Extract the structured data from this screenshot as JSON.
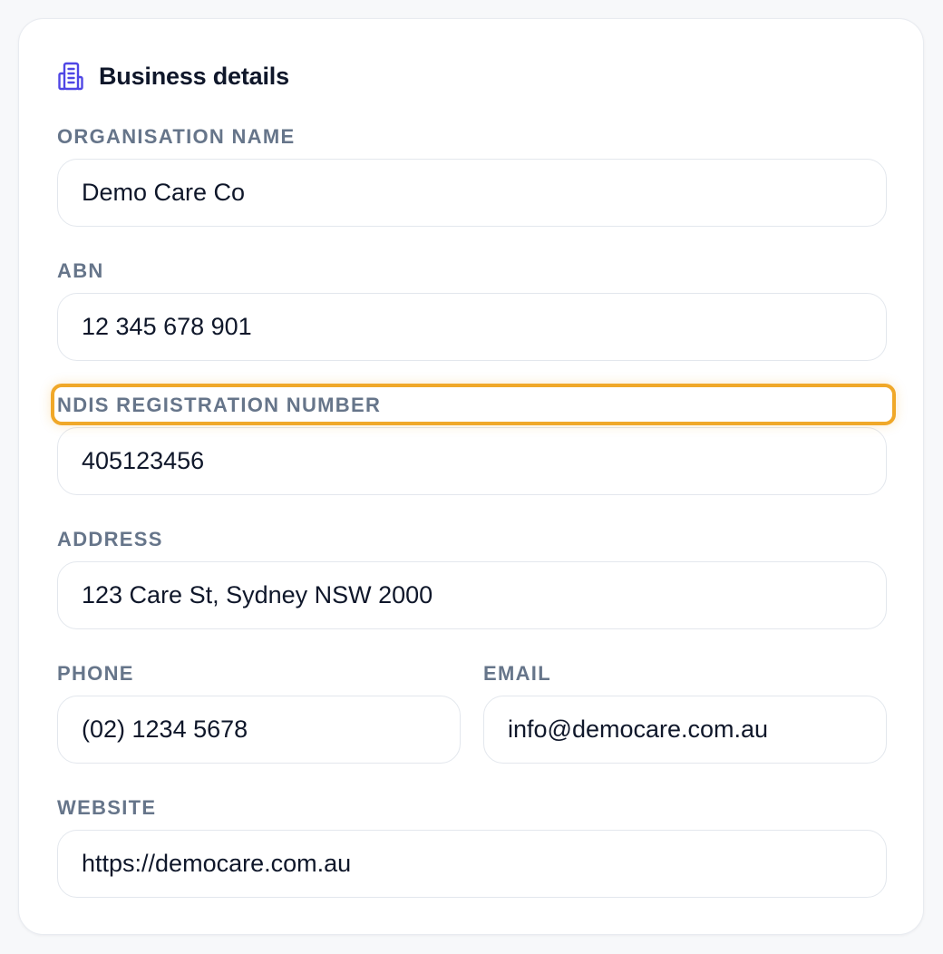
{
  "section": {
    "title": "Business details",
    "icon": "building-icon",
    "accent_color": "#4f46e5"
  },
  "fields": {
    "organisation_name": {
      "label": "Organisation name",
      "value": "Demo Care Co"
    },
    "abn": {
      "label": "ABN",
      "value": "12 345 678 901"
    },
    "ndis_registration_number": {
      "label": "NDIS registration number",
      "value": "405123456"
    },
    "address": {
      "label": "Address",
      "value": "123 Care St, Sydney NSW 2000"
    },
    "phone": {
      "label": "Phone",
      "value": "(02) 1234 5678"
    },
    "email": {
      "label": "Email",
      "value": "info@democare.com.au"
    },
    "website": {
      "label": "Website",
      "value": "https://democare.com.au"
    }
  },
  "highlight_color": "#f0a829"
}
